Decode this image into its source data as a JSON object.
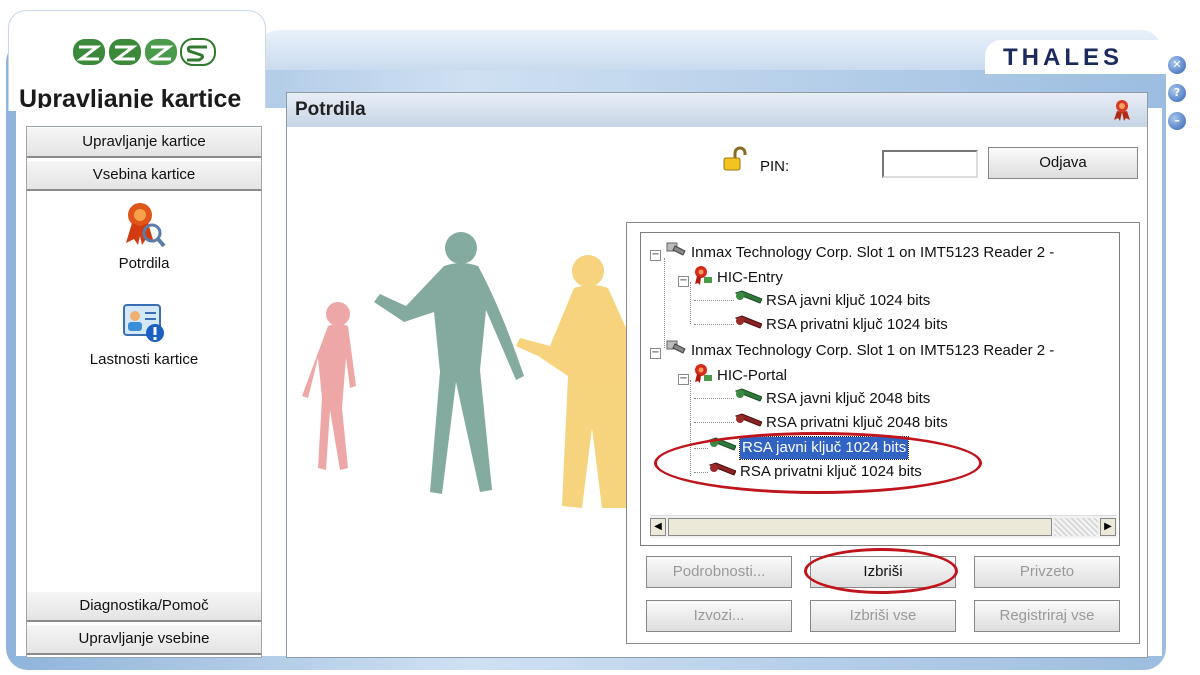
{
  "app": {
    "logo_text": "ZZZS",
    "title": "Upravljanje kartice",
    "brand": "THALES"
  },
  "window_controls": {
    "close_glyph": "✕",
    "help_glyph": "?",
    "minimize_glyph": "–"
  },
  "sidebar": {
    "top_items": [
      "Upravljanje kartice",
      "Vsebina kartice"
    ],
    "icon_items": [
      {
        "label": "Potrdila",
        "icon": "certificate-icon"
      },
      {
        "label": "Lastnosti kartice",
        "icon": "card-properties-icon"
      }
    ],
    "bottom_items": [
      "Diagnostika/Pomoč",
      "Upravljanje vsebine"
    ]
  },
  "panel": {
    "title": "Potrdila",
    "pin_label": "PIN:",
    "pin_value": "",
    "logout_button": "Odjava"
  },
  "tree": {
    "rows": [
      {
        "text": "Inmax Technology Corp. Slot 1 on IMT5123 Reader 2 -",
        "level": 0,
        "icon": "reader-icon",
        "expander": "−"
      },
      {
        "text": "HIC-Entry",
        "level": 1,
        "icon": "certificate-icon",
        "expander": "−"
      },
      {
        "text": "RSA javni ključ 1024 bits",
        "level": 2,
        "icon": "public-key-icon"
      },
      {
        "text": "RSA privatni ključ 1024 bits",
        "level": 2,
        "icon": "private-key-icon"
      },
      {
        "text": "Inmax Technology Corp. Slot 1 on IMT5123 Reader 2 -",
        "level": 0,
        "icon": "reader-icon",
        "expander": "−"
      },
      {
        "text": "HIC-Portal",
        "level": 1,
        "icon": "certificate-icon",
        "expander": "−"
      },
      {
        "text": "RSA javni ključ 2048 bits",
        "level": 2,
        "icon": "public-key-icon"
      },
      {
        "text": "RSA privatni ključ 2048 bits",
        "level": 2,
        "icon": "private-key-icon"
      },
      {
        "text": "RSA javni ključ 1024 bits",
        "level": 1,
        "icon": "public-key-icon",
        "selected": true
      },
      {
        "text": "RSA privatni ključ 1024 bits",
        "level": 1,
        "icon": "private-key-icon"
      }
    ]
  },
  "actions": {
    "details": "Podrobnosti...",
    "delete": "Izbriši",
    "default": "Privzeto",
    "export": "Izvozi...",
    "delete_all": "Izbriši vse",
    "register_all": "Registriraj vse"
  },
  "colors": {
    "selection": "#3163c5",
    "highlight_ellipse": "#c0141c",
    "figure_red": "#e88a8a",
    "figure_green": "#6f9c8f",
    "figure_yellow": "#f4c95c"
  }
}
